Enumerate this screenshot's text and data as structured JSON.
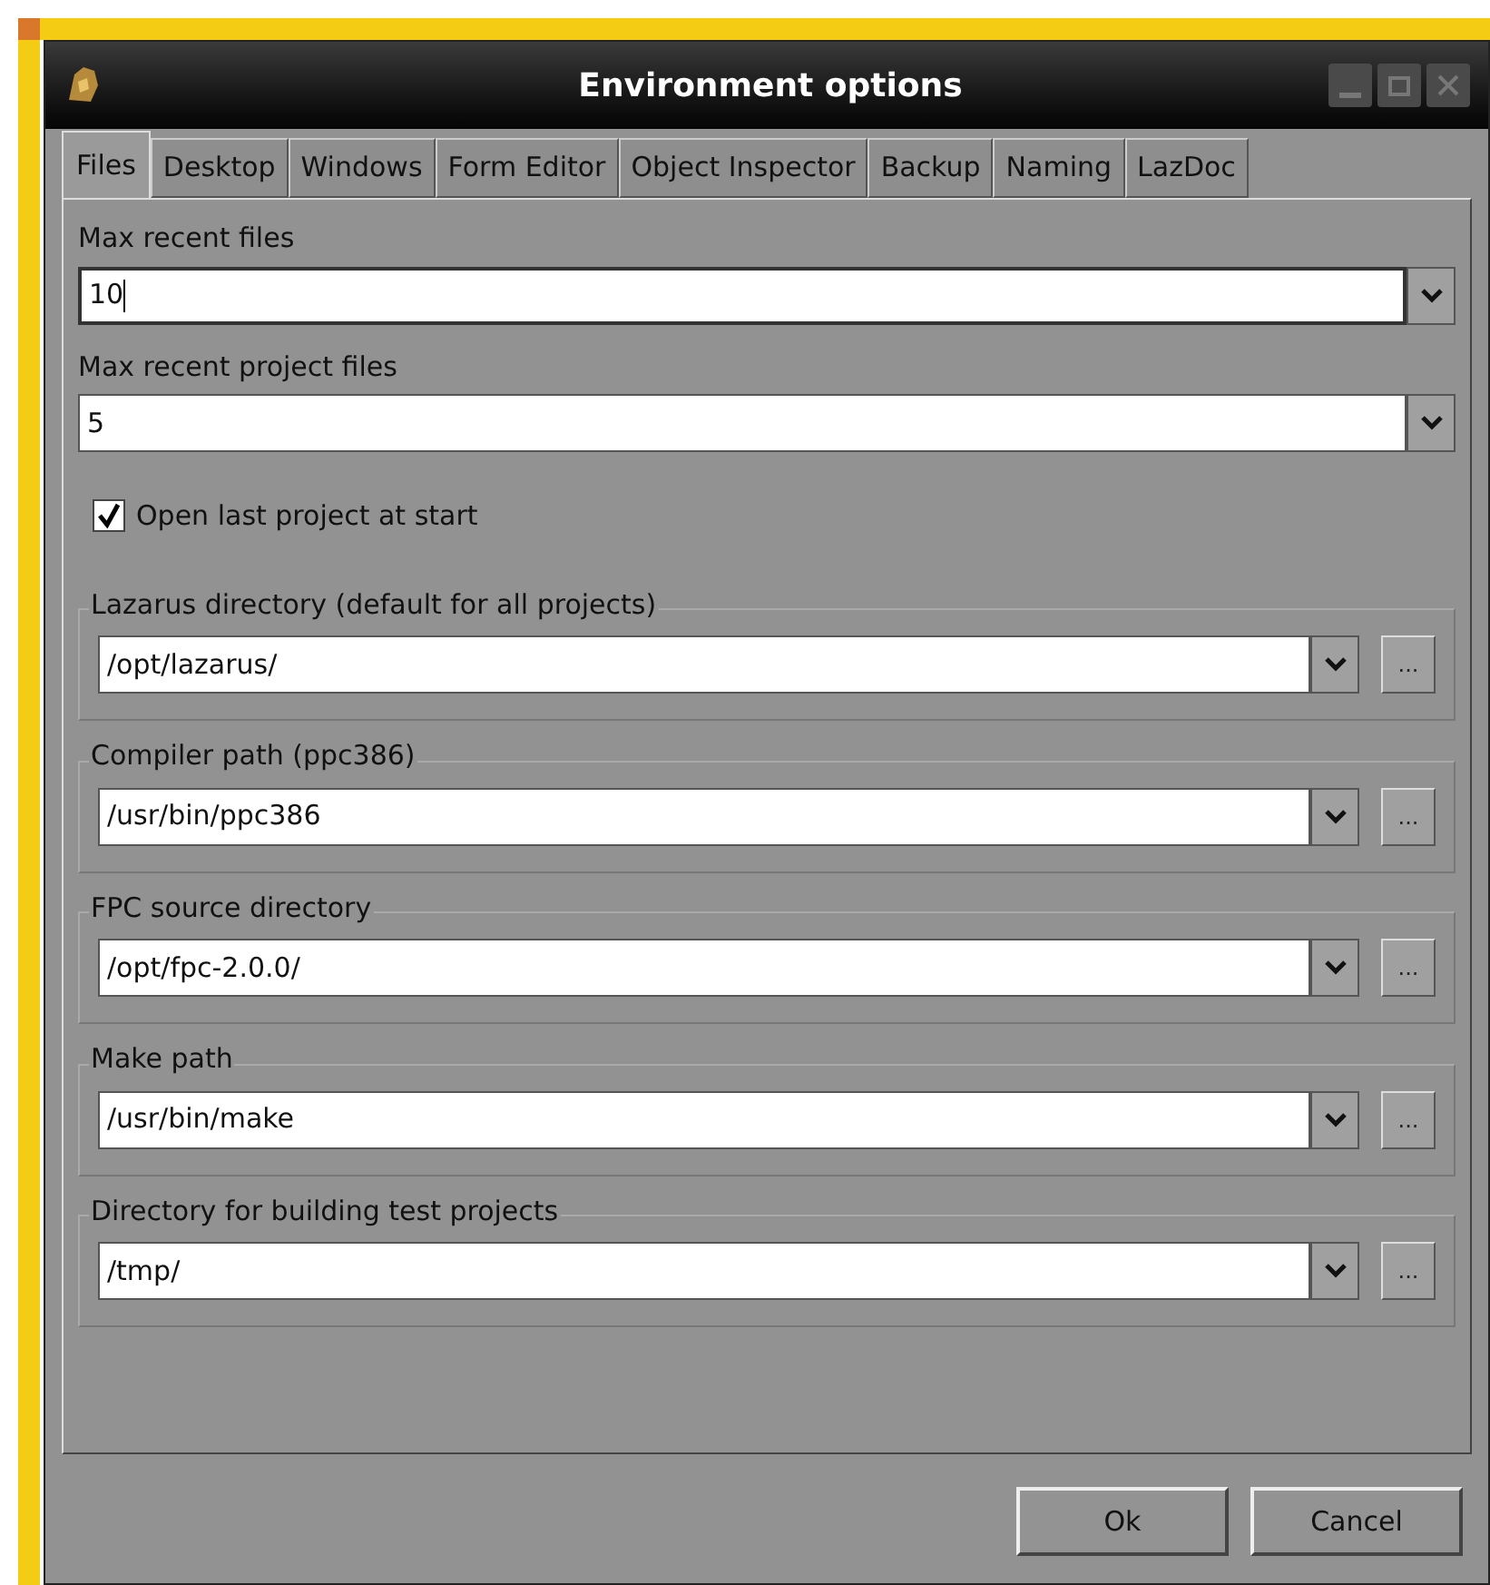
{
  "window": {
    "title": "Environment options"
  },
  "tabs": [
    {
      "label": "Files",
      "selected": true
    },
    {
      "label": "Desktop",
      "selected": false
    },
    {
      "label": "Windows",
      "selected": false
    },
    {
      "label": "Form Editor",
      "selected": false
    },
    {
      "label": "Object Inspector",
      "selected": false
    },
    {
      "label": "Backup",
      "selected": false
    },
    {
      "label": "Naming",
      "selected": false
    },
    {
      "label": "LazDoc",
      "selected": false
    }
  ],
  "combos": [
    {
      "label": "Max recent files",
      "value": "10",
      "focused": true
    },
    {
      "label": "Max recent project files",
      "value": "5",
      "focused": false
    }
  ],
  "checkbox": {
    "label": "Open last project at start",
    "checked": true
  },
  "path_groups": [
    {
      "title": "Lazarus directory (default for all projects)",
      "value": "/opt/lazarus/",
      "browse": "..."
    },
    {
      "title": "Compiler path (ppc386)",
      "value": "/usr/bin/ppc386",
      "browse": "..."
    },
    {
      "title": "FPC source directory",
      "value": "/opt/fpc-2.0.0/",
      "browse": "..."
    },
    {
      "title": "Make path",
      "value": "/usr/bin/make",
      "browse": "..."
    },
    {
      "title": "Directory for building test projects",
      "value": "/tmp/",
      "browse": "..."
    }
  ],
  "buttons": [
    "Ok",
    "Cancel"
  ]
}
